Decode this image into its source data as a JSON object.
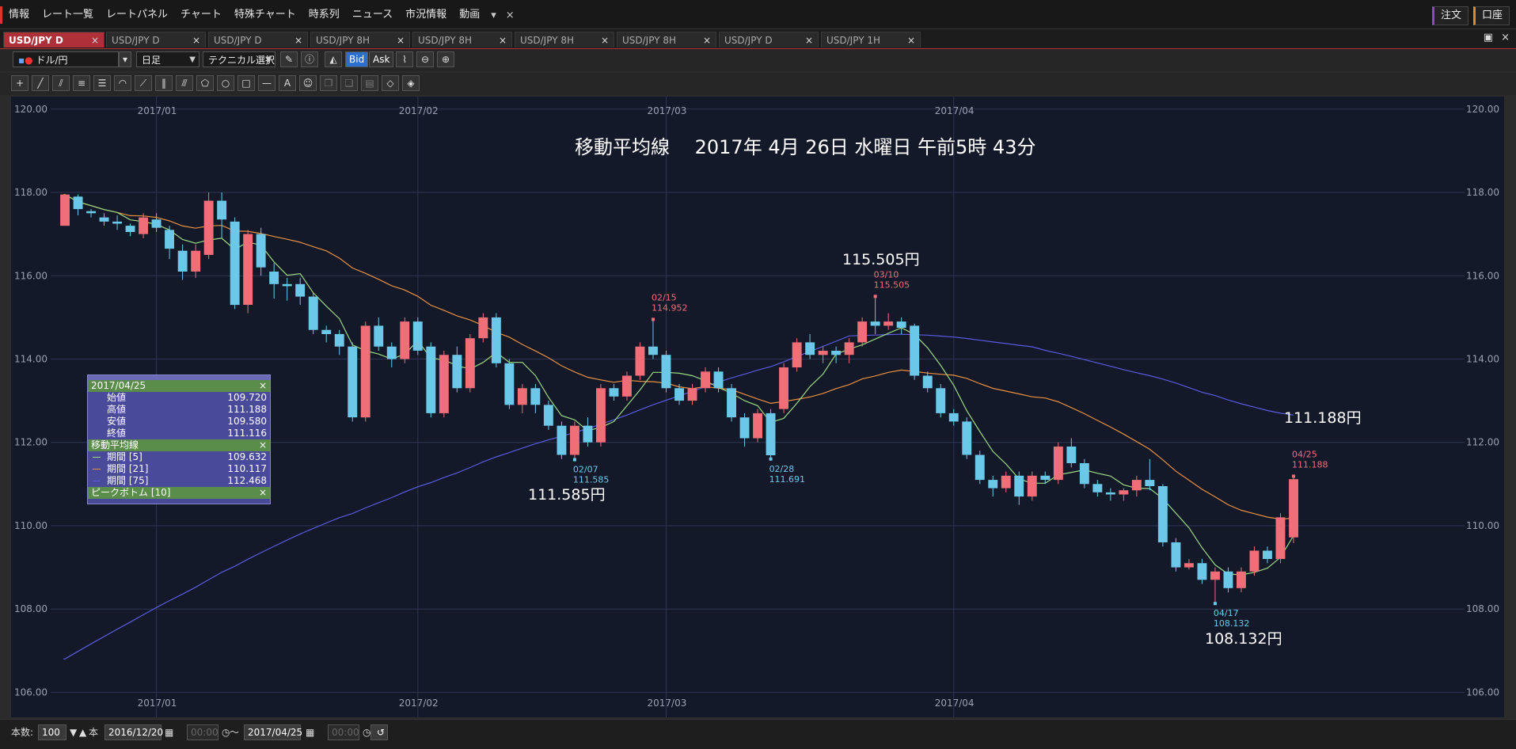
{
  "menubar": {
    "items": [
      "情報",
      "レート一覧",
      "レートパネル",
      "チャート",
      "特殊チャート",
      "時系列",
      "ニュース",
      "市況情報",
      "動画"
    ],
    "dropdown": "▾",
    "close": "×",
    "right_buttons": [
      "注文",
      "口座"
    ]
  },
  "tabs": [
    {
      "label": "USD/JPY D",
      "active": true
    },
    {
      "label": "USD/JPY D",
      "active": false
    },
    {
      "label": "USD/JPY D",
      "active": false
    },
    {
      "label": "USD/JPY 8H",
      "active": false
    },
    {
      "label": "USD/JPY 8H",
      "active": false
    },
    {
      "label": "USD/JPY 8H",
      "active": false
    },
    {
      "label": "USD/JPY 8H",
      "active": false
    },
    {
      "label": "USD/JPY D",
      "active": false
    },
    {
      "label": "USD/JPY 1H",
      "active": false
    }
  ],
  "tab_close": "×",
  "toolbar": {
    "pair": "ドル/円",
    "timeframe": "日足",
    "technical": "テクニカル選択",
    "bid": "Bid",
    "ask": "Ask"
  },
  "chart": {
    "title": "移動平均線　 2017年 4月 26日 水曜日 午前5時 43分",
    "callouts": {
      "high": "115.505円",
      "low1": "111.585円",
      "low2": "108.132円",
      "ma75": "111.188円"
    },
    "marks": [
      {
        "date": "02/15",
        "value": "114.952",
        "color": "#f06e78"
      },
      {
        "date": "02/07",
        "value": "111.585",
        "color": "#6cc8e8"
      },
      {
        "date": "03/10",
        "value": "115.505",
        "color": "#f06e78"
      },
      {
        "date": "02/28",
        "value": "111.691",
        "color": "#6cc8e8"
      },
      {
        "date": "04/17",
        "value": "108.132",
        "color": "#6cc8e8"
      },
      {
        "date": "04/25",
        "value": "111.188",
        "color": "#f06e78"
      }
    ]
  },
  "panel": {
    "date": "2017/04/25",
    "ohlc": [
      {
        "label": "始値",
        "value": "109.720"
      },
      {
        "label": "高値",
        "value": "111.188"
      },
      {
        "label": "安値",
        "value": "109.580"
      },
      {
        "label": "終値",
        "value": "111.116"
      }
    ],
    "ma_title": "移動平均線",
    "ma": [
      {
        "label": "期間 [5]",
        "value": "109.632",
        "color": "#9ad880"
      },
      {
        "label": "期間 [21]",
        "value": "110.117",
        "color": "#e89040"
      },
      {
        "label": "期間 [75]",
        "value": "112.468",
        "color": "#5a5ae0"
      }
    ],
    "peak_title": "ピークボトム [10]",
    "close": "×"
  },
  "bottom": {
    "count_label": "本数:",
    "count": "100",
    "unit": "本",
    "from_date": "2016/12/20",
    "from_time": "00:00",
    "tilde": "～",
    "to_date": "2017/04/25",
    "to_time": "00:00"
  },
  "chart_data": {
    "type": "candlestick",
    "title": "移動平均線",
    "xlabel": "",
    "ylabel": "",
    "ylim": [
      105.4,
      120.3
    ],
    "y_ticks": [
      "120.00",
      "118.00",
      "116.00",
      "114.00",
      "112.00",
      "110.00",
      "108.00",
      "106.00"
    ],
    "x_ticks": [
      "2017/01",
      "2017/02",
      "2017/03",
      "2017/04"
    ],
    "grid": true,
    "candles": [
      [
        117.2,
        117.95,
        117.3,
        117.85
      ],
      [
        117.9,
        117.6,
        117.45,
        117.95
      ],
      [
        117.55,
        117.5,
        117.4,
        117.6
      ],
      [
        117.4,
        117.3,
        117.2,
        117.5
      ],
      [
        117.3,
        117.25,
        117.1,
        117.45
      ],
      [
        117.2,
        117.05,
        116.95,
        117.25
      ],
      [
        117.0,
        117.4,
        116.9,
        117.5
      ],
      [
        117.35,
        117.15,
        117.05,
        117.5
      ],
      [
        117.1,
        116.65,
        116.4,
        117.2
      ],
      [
        116.6,
        116.1,
        115.9,
        116.75
      ],
      [
        116.1,
        116.6,
        115.95,
        116.75
      ],
      [
        116.5,
        117.8,
        116.4,
        118.0
      ],
      [
        117.8,
        117.35,
        116.9,
        118.0
      ],
      [
        117.3,
        115.3,
        115.2,
        117.4
      ],
      [
        115.3,
        117.0,
        115.1,
        117.1
      ],
      [
        117.0,
        116.2,
        116.0,
        117.15
      ],
      [
        116.1,
        115.8,
        115.45,
        116.3
      ],
      [
        115.8,
        115.75,
        115.4,
        115.95
      ],
      [
        115.8,
        115.5,
        115.3,
        115.95
      ],
      [
        115.5,
        114.7,
        114.6,
        115.6
      ],
      [
        114.7,
        114.6,
        114.4,
        114.8
      ],
      [
        114.6,
        114.3,
        114.1,
        114.7
      ],
      [
        114.3,
        112.6,
        112.5,
        114.4
      ],
      [
        112.6,
        114.8,
        112.5,
        114.9
      ],
      [
        114.8,
        114.3,
        114.2,
        115.0
      ],
      [
        114.3,
        114.0,
        113.8,
        114.4
      ],
      [
        114.0,
        114.9,
        113.9,
        115.0
      ],
      [
        114.9,
        114.2,
        114.1,
        115.0
      ],
      [
        114.3,
        112.7,
        112.6,
        114.4
      ],
      [
        112.7,
        114.1,
        112.6,
        114.2
      ],
      [
        114.1,
        113.3,
        113.2,
        114.3
      ],
      [
        113.3,
        114.5,
        113.2,
        114.6
      ],
      [
        114.5,
        115.0,
        114.4,
        115.1
      ],
      [
        115.0,
        113.9,
        113.8,
        115.1
      ],
      [
        113.9,
        112.9,
        112.8,
        114.0
      ],
      [
        112.9,
        113.3,
        112.7,
        113.4
      ],
      [
        113.3,
        112.9,
        112.7,
        113.4
      ],
      [
        112.9,
        112.4,
        112.3,
        113.0
      ],
      [
        112.4,
        111.7,
        111.6,
        112.5
      ],
      [
        111.7,
        112.4,
        111.585,
        112.5
      ],
      [
        112.4,
        112.0,
        111.9,
        112.6
      ],
      [
        112.0,
        113.3,
        111.9,
        113.4
      ],
      [
        113.3,
        113.1,
        113.0,
        113.4
      ],
      [
        113.1,
        113.6,
        113.0,
        113.7
      ],
      [
        113.6,
        114.3,
        113.5,
        114.4
      ],
      [
        114.3,
        114.1,
        114.0,
        114.952
      ],
      [
        114.1,
        113.3,
        113.2,
        114.2
      ],
      [
        113.3,
        113.0,
        112.9,
        113.4
      ],
      [
        113.0,
        113.3,
        112.9,
        113.4
      ],
      [
        113.3,
        113.7,
        113.2,
        113.8
      ],
      [
        113.7,
        113.3,
        113.2,
        113.8
      ],
      [
        113.3,
        112.6,
        112.5,
        113.4
      ],
      [
        112.6,
        112.1,
        111.9,
        112.7
      ],
      [
        112.1,
        112.7,
        112.0,
        112.8
      ],
      [
        112.7,
        111.691,
        111.6,
        112.8
      ],
      [
        112.8,
        113.8,
        112.7,
        113.9
      ],
      [
        113.8,
        114.4,
        113.7,
        114.5
      ],
      [
        114.4,
        114.1,
        114.0,
        114.6
      ],
      [
        114.1,
        114.2,
        113.9,
        114.3
      ],
      [
        114.2,
        114.1,
        113.9,
        114.3
      ],
      [
        114.1,
        114.4,
        113.9,
        114.5
      ],
      [
        114.4,
        114.9,
        114.3,
        115.0
      ],
      [
        114.9,
        114.8,
        114.6,
        115.505
      ],
      [
        114.8,
        114.9,
        114.7,
        115.1
      ],
      [
        114.9,
        114.75,
        114.6,
        115.0
      ],
      [
        114.8,
        113.6,
        113.5,
        114.85
      ],
      [
        113.6,
        113.3,
        113.2,
        113.7
      ],
      [
        113.3,
        112.7,
        112.6,
        113.4
      ],
      [
        112.7,
        112.5,
        112.4,
        112.8
      ],
      [
        112.5,
        111.7,
        111.6,
        112.6
      ],
      [
        111.7,
        111.1,
        111.0,
        111.8
      ],
      [
        111.1,
        110.9,
        110.7,
        111.2
      ],
      [
        110.9,
        111.2,
        110.8,
        111.3
      ],
      [
        111.2,
        110.7,
        110.5,
        111.3
      ],
      [
        110.7,
        111.2,
        110.6,
        111.3
      ],
      [
        111.2,
        111.1,
        111.0,
        111.3
      ],
      [
        111.1,
        111.9,
        111.0,
        112.0
      ],
      [
        111.9,
        111.5,
        111.4,
        112.1
      ],
      [
        111.5,
        111.0,
        110.9,
        111.6
      ],
      [
        111.0,
        110.8,
        110.7,
        111.1
      ],
      [
        110.8,
        110.75,
        110.6,
        110.9
      ],
      [
        110.75,
        110.85,
        110.6,
        110.9
      ],
      [
        110.85,
        111.1,
        110.7,
        111.2
      ],
      [
        111.1,
        110.95,
        110.85,
        111.6
      ],
      [
        110.95,
        109.6,
        109.5,
        111.0
      ],
      [
        109.6,
        109.0,
        108.9,
        109.7
      ],
      [
        109.0,
        109.1,
        108.95,
        109.2
      ],
      [
        109.1,
        108.7,
        108.6,
        109.2
      ],
      [
        108.7,
        108.9,
        108.132,
        109.0
      ],
      [
        108.9,
        108.5,
        108.4,
        109.0
      ],
      [
        108.5,
        108.9,
        108.4,
        109.0
      ],
      [
        108.9,
        109.4,
        108.8,
        109.5
      ],
      [
        109.4,
        109.2,
        109.1,
        109.5
      ],
      [
        109.2,
        110.2,
        109.1,
        110.3
      ],
      [
        109.72,
        111.116,
        109.58,
        111.188
      ]
    ],
    "series": [
      {
        "name": "期間 [5]",
        "color": "#9ad880"
      },
      {
        "name": "期間 [21]",
        "color": "#e89040"
      },
      {
        "name": "期間 [75]",
        "color": "#5a5ae0"
      }
    ],
    "ma75_start": 106.8
  }
}
